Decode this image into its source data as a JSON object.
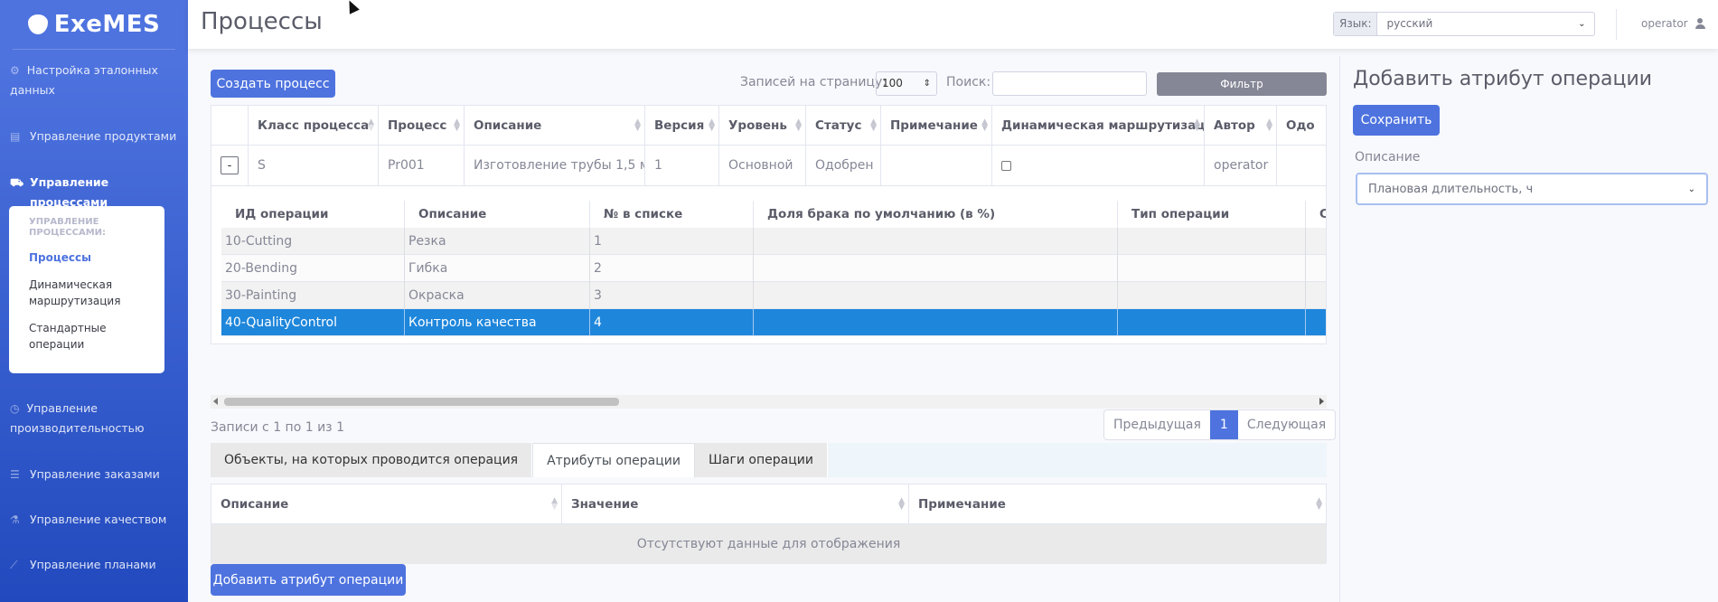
{
  "brand": {
    "name": "ExeMES"
  },
  "sidebar": {
    "items": [
      {
        "label": "Настройка эталонных данных",
        "icon": "gear-icon"
      },
      {
        "label": "Управление продуктами",
        "icon": "box-icon"
      },
      {
        "label": "Управление процессами",
        "icon": "truck-icon"
      },
      {
        "label": "Управление производительностью",
        "icon": "clock-icon"
      },
      {
        "label": "Управление заказами",
        "icon": "list-icon"
      },
      {
        "label": "Управление качеством",
        "icon": "flask-icon"
      },
      {
        "label": "Управление планами",
        "icon": "chart-icon"
      }
    ],
    "submenu": {
      "header": "УПРАВЛЕНИЕ ПРОЦЕССАМИ:",
      "items": [
        "Процессы",
        "Динамическая маршрутизация",
        "Стандартные операции"
      ]
    }
  },
  "topbar": {
    "title": "Процессы",
    "lang_label": "Язык:",
    "lang_value": "русский",
    "user": "operator"
  },
  "toolbar": {
    "create_label": "Создать процесс",
    "per_page_label": "Записей на страницу:",
    "per_page_value": "100",
    "search_label": "Поиск:",
    "search_value": "",
    "filter_label": "Фильтр"
  },
  "process_table": {
    "columns": [
      "Класс процесса",
      "Процесс",
      "Описание",
      "Версия",
      "Уровень",
      "Статус",
      "Примечание",
      "Динамическая маршрутизация",
      "Автор",
      "Одо"
    ],
    "row": {
      "toggle": "-",
      "class": "S",
      "process": "Pr001",
      "description": "Изготовление трубы 1,5 м",
      "version": "1",
      "level": "Основной",
      "status": "Одобрен",
      "note": "",
      "author": "operator"
    }
  },
  "operations_table": {
    "columns": [
      "ИД операции",
      "Описание",
      "№ в списке",
      "Доля брака по умолчанию (в %)",
      "Тип операции",
      "С"
    ],
    "rows": [
      {
        "id": "10-Cutting",
        "desc": "Резка",
        "num": "1"
      },
      {
        "id": "20-Bending",
        "desc": "Гибка",
        "num": "2"
      },
      {
        "id": "30-Painting",
        "desc": "Окраска",
        "num": "3"
      },
      {
        "id": "40-QualityControl",
        "desc": "Контроль качества",
        "num": "4"
      }
    ]
  },
  "pagination": {
    "info": "Записи с 1 по 1 из 1",
    "prev": "Предыдущая",
    "current": "1",
    "next": "Следующая"
  },
  "tabs": [
    "Объекты, на которых проводится операция",
    "Атрибуты операции",
    "Шаги операции"
  ],
  "attr_table": {
    "columns": [
      "Описание",
      "Значение",
      "Примечание"
    ],
    "empty": "Отсутствуют данные для отображения",
    "add_label": "Добавить атрибут операции"
  },
  "panel": {
    "title": "Добавить атрибут операции",
    "save_label": "Сохранить",
    "desc_label": "Описание",
    "desc_value": "Плановая длительность, ч"
  },
  "colors": {
    "primary": "#4e73df",
    "selected_row": "#1e86db",
    "filter_button": "#858796"
  }
}
